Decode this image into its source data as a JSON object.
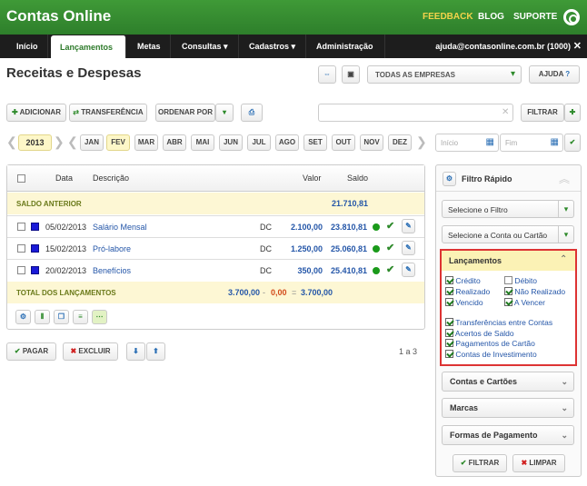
{
  "app": {
    "logo": "Contas Online",
    "links": [
      "FEEDBACK",
      "BLOG",
      "SUPORTE"
    ],
    "user": "ajuda@contasonline.com.br (1000)"
  },
  "nav": [
    "Início",
    "Lançamentos",
    "Metas",
    "Consultas",
    "Cadastros",
    "Administração"
  ],
  "page": {
    "title": "Receitas e Despesas",
    "company_select": "TODAS AS EMPRESAS",
    "help": "AJUDA"
  },
  "toolbar": {
    "adicionar": "ADICIONAR",
    "transferencia": "TRANSFERÊNCIA",
    "ordenar": "ORDENAR POR",
    "filtrar": "FILTRAR",
    "search_placeholder": ""
  },
  "calendar": {
    "year": "2013",
    "months": [
      "JAN",
      "FEV",
      "MAR",
      "ABR",
      "MAI",
      "JUN",
      "JUL",
      "AGO",
      "SET",
      "OUT",
      "NOV",
      "DEZ"
    ],
    "selected": "FEV",
    "inicio_placeholder": "Início",
    "fim_placeholder": "Fim"
  },
  "table": {
    "headers": {
      "data": "Data",
      "descricao": "Descrição",
      "valor": "Valor",
      "saldo": "Saldo"
    },
    "saldo_anterior": {
      "label": "SALDO ANTERIOR",
      "value": "21.710,81"
    },
    "rows": [
      {
        "date": "05/02/2013",
        "desc": "Salário Mensal",
        "type": "DC",
        "valor": "2.100,00",
        "saldo": "23.810,81"
      },
      {
        "date": "15/02/2013",
        "desc": "Pró-labore",
        "type": "DC",
        "valor": "1.250,00",
        "saldo": "25.060,81"
      },
      {
        "date": "20/02/2013",
        "desc": "Benefícios",
        "type": "DC",
        "valor": "350,00",
        "saldo": "25.410,81"
      }
    ],
    "total": {
      "label": "TOTAL DOS LANÇAMENTOS",
      "receitas": "3.700,00",
      "sep1": "-",
      "despesas": "0,00",
      "sep2": "=",
      "resultado": "3.700,00"
    }
  },
  "actions": {
    "pagar": "PAGAR",
    "excluir": "EXCLUIR",
    "pagination": "1 a 3"
  },
  "filter": {
    "title": "Filtro Rápido",
    "select_filter": "Selecione o Filtro",
    "select_account": "Selecione a Conta ou Cartão",
    "lancamentos": {
      "title": "Lançamentos",
      "options": [
        {
          "label": "Crédito",
          "checked": true
        },
        {
          "label": "Débito",
          "checked": false
        },
        {
          "label": "Realizado",
          "checked": true
        },
        {
          "label": "Não Realizado",
          "checked": true
        },
        {
          "label": "Vencido",
          "checked": true
        },
        {
          "label": "A Vencer",
          "checked": true
        }
      ],
      "extras": [
        {
          "label": "Transferências entre Contas",
          "checked": true
        },
        {
          "label": "Acertos de Saldo",
          "checked": true
        },
        {
          "label": "Pagamentos de Cartão",
          "checked": true
        },
        {
          "label": "Contas de Investimento",
          "checked": true
        }
      ]
    },
    "sections": [
      "Contas e Cartões",
      "Marcas",
      "Formas de Pagamento"
    ],
    "filtrar": "FILTRAR",
    "limpar": "LIMPAR"
  },
  "colors": {
    "green": "#2e8a2b",
    "highlight": "#d33",
    "accent_yellow": "#f2d34b"
  }
}
